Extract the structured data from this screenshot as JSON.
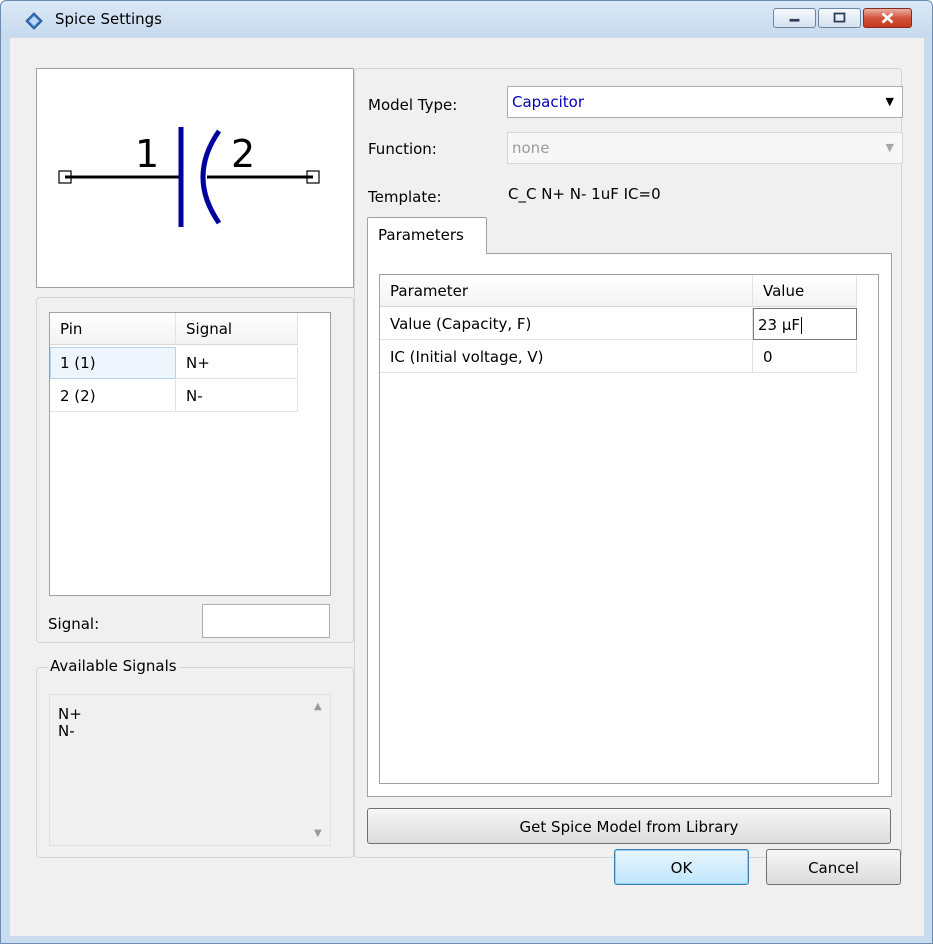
{
  "window": {
    "title": "Spice Settings",
    "controls": [
      "minimize",
      "maximize",
      "close"
    ]
  },
  "symbol_preview": {
    "pin1_label": "1",
    "pin2_label": "2",
    "color": "#0000a0"
  },
  "pins_table": {
    "headers": [
      "Pin",
      "Signal"
    ],
    "rows": [
      {
        "pin": "1 (1)",
        "signal": "N+"
      },
      {
        "pin": "2 (2)",
        "signal": "N-"
      }
    ]
  },
  "signal_field": {
    "label": "Signal:",
    "value": ""
  },
  "available_signals": {
    "legend": "Available Signals",
    "items": [
      "N+",
      "N-"
    ]
  },
  "model": {
    "model_type_label": "Model Type:",
    "model_type_value": "Capacitor",
    "function_label": "Function:",
    "function_value": "none",
    "template_label": "Template:",
    "template_value": "C_C N+ N- 1uF IC=0",
    "link_color": "#0000c0"
  },
  "tabs": [
    "Parameters"
  ],
  "parameters_table": {
    "headers": [
      "Parameter",
      "Value"
    ],
    "rows": [
      {
        "parameter": "Value (Capacity, F)",
        "value": "23 µF"
      },
      {
        "parameter": "IC (Initial voltage, V)",
        "value": "0"
      }
    ]
  },
  "buttons": {
    "library": "Get Spice Model from Library",
    "ok": "OK",
    "cancel": "Cancel"
  }
}
